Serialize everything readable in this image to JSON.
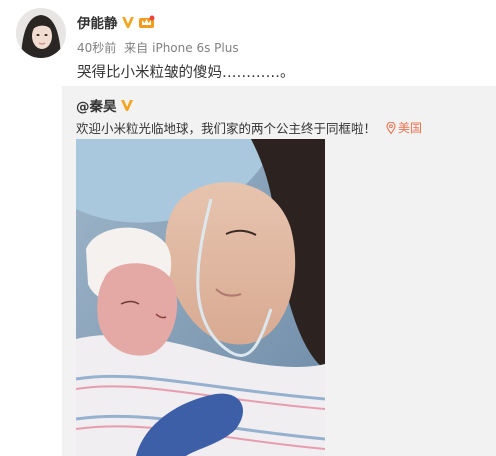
{
  "post": {
    "author": "伊能静",
    "time": "40秒前",
    "source_prefix": "来自",
    "source": "iPhone 6s Plus",
    "text": "哭得比小米粒皱的傻妈…………。"
  },
  "repost": {
    "author": "@秦昊",
    "text": "欢迎小米粒光临地球，我们家的两个公主终于同框啦！",
    "location": "美国"
  },
  "colors": {
    "verified_gold": "#f2a51e",
    "location_orange": "#eb7350",
    "repost_bg": "#f2f2f2"
  },
  "icons": {
    "verified": "v-badge-icon",
    "vip": "crown-icon",
    "location": "location-pin-icon"
  }
}
